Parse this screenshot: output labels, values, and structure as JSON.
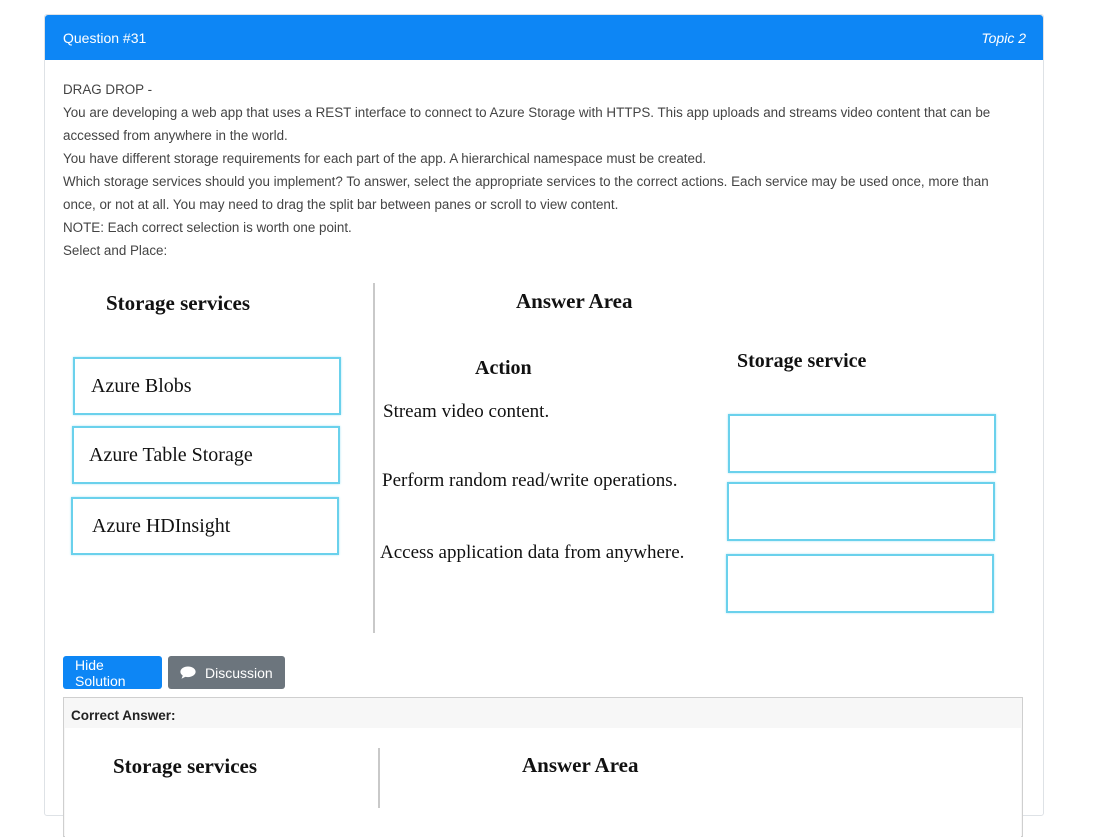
{
  "header": {
    "question_label": "Question #31",
    "topic_label": "Topic 2"
  },
  "question": {
    "type_label": "DRAG DROP -",
    "paragraphs": [
      "You are developing a web app that uses a REST interface to connect to Azure Storage with HTTPS. This app uploads and streams video content that can be accessed from anywhere in the world.",
      "You have different storage requirements for each part of the app. A hierarchical namespace must be created.",
      "Which storage services should you implement? To answer, select the appropriate services to the correct actions. Each service may be used once, more than once, or not at all. You may need to drag the split bar between panes or scroll to view content.",
      "NOTE: Each correct selection is worth one point.",
      "Select and Place:"
    ]
  },
  "figure": {
    "services_title": "Storage services",
    "answer_area_title": "Answer Area",
    "action_header": "Action",
    "storage_service_header": "Storage service",
    "services": [
      "Azure Blobs",
      "Azure Table Storage",
      "Azure HDInsight"
    ],
    "actions": [
      "Stream video content.",
      "Perform random read/write operations.",
      "Access application data from anywhere."
    ]
  },
  "buttons": {
    "hide_solution": "Hide Solution",
    "discussion": "Discussion"
  },
  "answer": {
    "label": "Correct Answer:",
    "services_title": "Storage services",
    "answer_area_title": "Answer Area"
  },
  "colors": {
    "primary": "#0d86f5",
    "secondary": "#6c757d",
    "box_border": "#6ad1ec"
  }
}
